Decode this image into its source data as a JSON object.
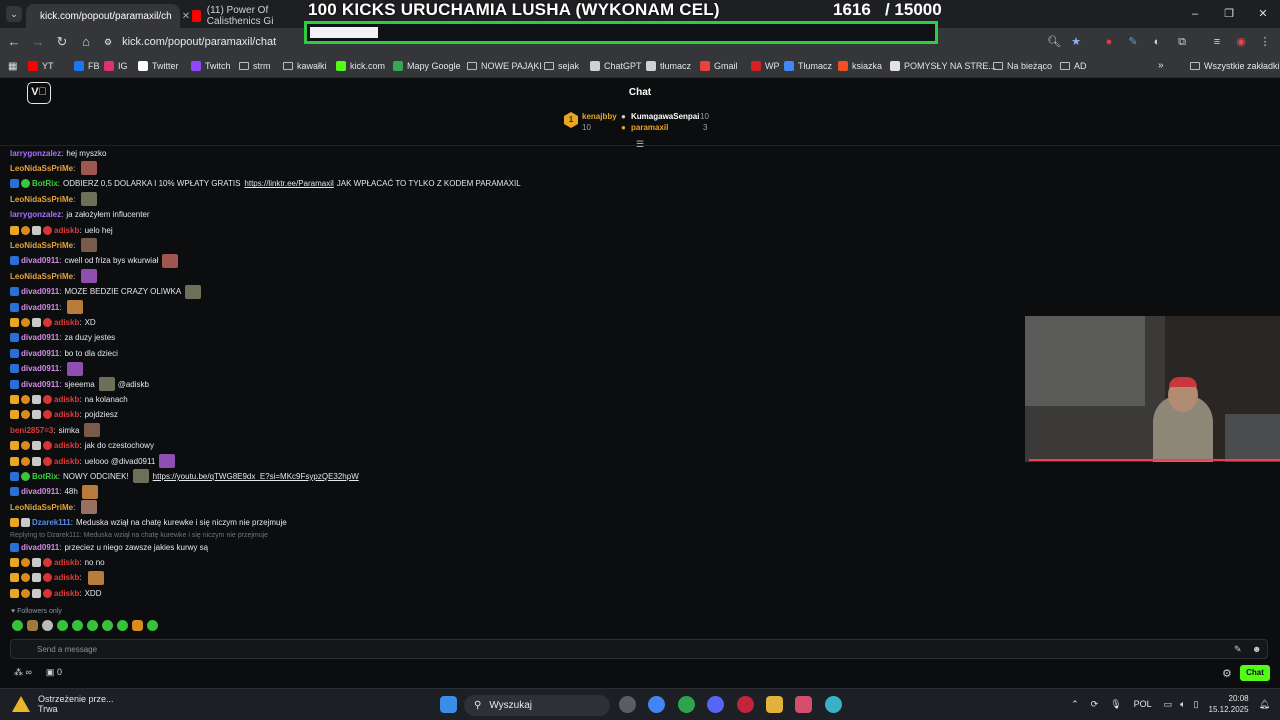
{
  "browser": {
    "tabs": [
      {
        "title": "kick.com/popout/paramaxil/ch",
        "active": true
      },
      {
        "title": "(11) Power Of Calisthenics Gi",
        "active": false
      }
    ],
    "url": "kick.com/popout/paramaxil/chat",
    "window_controls": [
      "–",
      "❐",
      "✕"
    ]
  },
  "overlay": {
    "title": "100 KICKS URUCHAMIA LUSHA (WYKONAM CEL)",
    "count": "1616   / 15000",
    "progress": 0.108,
    "border_color": "#2ecc40"
  },
  "bookmarks": [
    {
      "label": "YT",
      "icon": "youtube-icon"
    },
    {
      "label": "FB",
      "icon": "facebook-icon"
    },
    {
      "label": "IG",
      "icon": "instagram-icon"
    },
    {
      "label": "Twitter",
      "icon": "x-icon"
    },
    {
      "label": "Twitch",
      "icon": "twitch-icon"
    },
    {
      "label": "strm",
      "icon": "folder-icon"
    },
    {
      "label": "kawałki",
      "icon": "folder-icon"
    },
    {
      "label": "kick.com",
      "icon": "kick-icon"
    },
    {
      "label": "Mapy Google",
      "icon": "maps-icon"
    },
    {
      "label": "NOWE PAJĄKI",
      "icon": "folder-icon"
    },
    {
      "label": "sejak",
      "icon": "folder-icon"
    },
    {
      "label": "ChatGPT",
      "icon": "chatgpt-icon"
    },
    {
      "label": "tłumacz",
      "icon": "chatgpt-icon"
    },
    {
      "label": "Gmail",
      "icon": "gmail-icon"
    },
    {
      "label": "WP",
      "icon": "wp-icon"
    },
    {
      "label": "Tłumacz",
      "icon": "translate-icon"
    },
    {
      "label": "ksiazka",
      "icon": "microsoft-icon"
    },
    {
      "label": "POMYSŁY NA STRE...",
      "icon": "notion-icon"
    },
    {
      "label": "Na bieżąco",
      "icon": "folder-icon"
    },
    {
      "label": "AD",
      "icon": "folder-icon"
    }
  ],
  "bookmarks_right": "Wszystkie zakładki",
  "kick": {
    "header_title": "Chat",
    "leaderboard": [
      {
        "name": "kenajbby",
        "count": "10",
        "rank": "1"
      },
      {
        "name": "KumagawaSenpai",
        "count": "10"
      },
      {
        "name": "paramaxil",
        "count": "3"
      }
    ],
    "messages": [
      {
        "user": "larrygonzalez",
        "color": "#a970ff",
        "badges": [],
        "text": "hej myszko"
      },
      {
        "user": "LeoNidaSsPriMe",
        "color": "#e8a33a",
        "badges": [],
        "text": "",
        "emote": true
      },
      {
        "user": "BotRix",
        "color": "#3ad13a",
        "badges": [
          "kick",
          "bot"
        ],
        "text": "ODBIERZ 0,5 DOLARKA I 10% WPŁATY GRATIS",
        "link": "https://linktr.ee/Paramaxil",
        "after": "JAK WPŁACAĆ TO TYLKO Z KODEM PARAMAXIL"
      },
      {
        "user": "LeoNidaSsPriMe",
        "color": "#e8a33a",
        "badges": [],
        "text": "",
        "emote": true
      },
      {
        "user": "larrygonzalez",
        "color": "#a970ff",
        "badges": [],
        "text": "ja założyłem influcenter"
      },
      {
        "user": "adiskb",
        "color": "#e03a3a",
        "badges": [
          "crown",
          "gift",
          "sub",
          "mod"
        ],
        "text": "uelo hej"
      },
      {
        "user": "LeoNidaSsPriMe",
        "color": "#e8a33a",
        "badges": [],
        "text": "",
        "emote": true
      },
      {
        "user": "divad0911",
        "color": "#d38ce6",
        "badges": [
          "kick"
        ],
        "text": "cwell od friza bys wkurwiał",
        "emote": true
      },
      {
        "user": "LeoNidaSsPriMe",
        "color": "#e8a33a",
        "badges": [],
        "text": "",
        "emote": true
      },
      {
        "user": "divad0911",
        "color": "#d38ce6",
        "badges": [
          "kick"
        ],
        "text": "MOZE BEDZIE CRAZY OLIWKA",
        "emote": true
      },
      {
        "user": "divad0911",
        "color": "#d38ce6",
        "badges": [
          "kick"
        ],
        "text": "",
        "emote": true
      },
      {
        "user": "adiskb",
        "color": "#e03a3a",
        "badges": [
          "crown",
          "gift",
          "sub",
          "mod"
        ],
        "text": "XD"
      },
      {
        "user": "divad0911",
        "color": "#d38ce6",
        "badges": [
          "kick"
        ],
        "text": "za duzy jestes"
      },
      {
        "user": "divad0911",
        "color": "#d38ce6",
        "badges": [
          "kick"
        ],
        "text": "bo to dla dzieci"
      },
      {
        "user": "divad0911",
        "color": "#d38ce6",
        "badges": [
          "kick"
        ],
        "text": "",
        "emote": true
      },
      {
        "user": "divad0911",
        "color": "#d38ce6",
        "badges": [
          "kick"
        ],
        "text": "sjeeema",
        "emote": true,
        "after": "@adiskb"
      },
      {
        "user": "adiskb",
        "color": "#e03a3a",
        "badges": [
          "crown",
          "gift",
          "sub",
          "mod"
        ],
        "text": "na kolanach"
      },
      {
        "user": "adiskb",
        "color": "#e03a3a",
        "badges": [
          "crown",
          "gift",
          "sub",
          "mod"
        ],
        "text": "pojdziesz"
      },
      {
        "user": "beni2857=3",
        "color": "#e03a3a",
        "badges": [],
        "text": "simka",
        "emote": true
      },
      {
        "user": "adiskb",
        "color": "#e03a3a",
        "badges": [
          "crown",
          "gift",
          "sub",
          "mod"
        ],
        "text": "jak do czestochowy"
      },
      {
        "user": "adiskb",
        "color": "#e03a3a",
        "badges": [
          "crown",
          "gift",
          "sub",
          "mod"
        ],
        "text": "uelooo @divad0911",
        "emote": true
      },
      {
        "user": "BotRix",
        "color": "#3ad13a",
        "badges": [
          "kick",
          "bot"
        ],
        "text": "NOWY ODCINEK!",
        "emote": true,
        "link": "https://youtu.be/qTWG8E9dx_E?si=MKc9FsypzQE32hpW"
      },
      {
        "user": "divad0911",
        "color": "#d38ce6",
        "badges": [
          "kick"
        ],
        "text": "48h",
        "emote": true
      },
      {
        "user": "LeoNidaSsPriMe",
        "color": "#e8a33a",
        "badges": [],
        "text": "",
        "emote": true
      },
      {
        "user": "Dzarek111",
        "color": "#5a8cf0",
        "badges": [
          "crown",
          "sub"
        ],
        "text": "Meduska wziął na chatę kurewke i się niczym nie przejmuje"
      },
      {
        "reply": "Replying to Dzarek111: Meduska wziął na chatę kurewke i się niczym nie przejmuje"
      },
      {
        "user": "divad0911",
        "color": "#d38ce6",
        "badges": [
          "kick"
        ],
        "text": "przeciez u niego zawsze jakies kurwy są"
      },
      {
        "user": "adiskb",
        "color": "#e03a3a",
        "badges": [
          "crown",
          "gift",
          "sub",
          "mod"
        ],
        "text": "no no"
      },
      {
        "user": "adiskb",
        "color": "#e03a3a",
        "badges": [
          "crown",
          "gift",
          "sub",
          "mod"
        ],
        "text": "",
        "emote": true
      },
      {
        "user": "adiskb",
        "color": "#e03a3a",
        "badges": [
          "crown",
          "gift",
          "sub",
          "mod"
        ],
        "text": "XDD"
      }
    ],
    "followers_only": "Followers only",
    "input_placeholder": "Send a message",
    "footer_count": "0",
    "chat_button": "Chat",
    "accent": "#53fc18"
  },
  "taskbar": {
    "weather_title": "Ostrzeżenie prze...",
    "weather_sub": "Trwa",
    "search_placeholder": "Wyszukaj",
    "lang": "POL",
    "time": "20:08",
    "date": "15.12.2025"
  }
}
